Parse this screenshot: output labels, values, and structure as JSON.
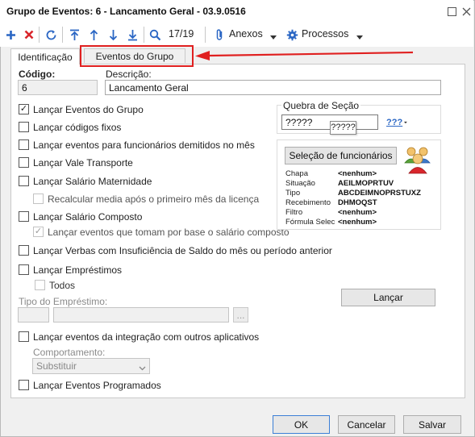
{
  "window": {
    "title": "Grupo de Eventos: 6 - Lancamento Geral - 03.9.0516"
  },
  "toolbar": {
    "record_counter": "17/19",
    "anexos_label": "Anexos",
    "processos_label": "Processos"
  },
  "tabs": [
    {
      "label": "Identificação"
    },
    {
      "label": "Eventos do Grupo"
    }
  ],
  "fields": {
    "codigo_label": "Código:",
    "codigo_value": "6",
    "descricao_label": "Descrição:",
    "descricao_value": "Lancamento Geral"
  },
  "options": {
    "lancar_eventos_grupo": "Lançar Eventos do Grupo",
    "lancar_codigos_fixos": "Lançar códigos fixos",
    "lancar_demitidos": "Lançar eventos para funcionários demitidos no mês",
    "lancar_vale_transporte": "Lançar Vale Transporte",
    "lancar_salario_maternidade": "Lançar Salário Maternidade",
    "recalcular_media": "Recalcular media após o primeiro mês da licença",
    "lancar_salario_composto": "Lançar Salário Composto",
    "lancar_eventos_base": "Lançar eventos que tomam por base o salário composto",
    "lancar_verbas_insuficiencia": "Lançar Verbas com Insuficiência de Saldo do mês ou período anterior",
    "lancar_emprestimos": "Lançar Empréstimos",
    "todos": "Todos",
    "tipo_emprestimo_label": "Tipo do Empréstimo:",
    "lancar_integracao": "Lançar eventos da integração com outros aplicativos",
    "comportamento_label": "Comportamento:",
    "comportamento_value": "Substituir",
    "lancar_programados": "Lançar Eventos Programados"
  },
  "quebra": {
    "label": "Quebra de Seção",
    "value": "?????",
    "tooltip": "?????",
    "selector_text": "???"
  },
  "selecao": {
    "button_label": "Seleção de funcionários",
    "rows": [
      {
        "key": "Chapa",
        "value": "<nenhum>"
      },
      {
        "key": "Situação",
        "value": "AEILMOPRTUV"
      },
      {
        "key": "Tipo",
        "value": "ABCDEIMNOPRSTUXZ"
      },
      {
        "key": "Recebimento",
        "value": "DHMOQST"
      },
      {
        "key": "Filtro",
        "value": "<nenhum>"
      },
      {
        "key": "Fórmula Selec",
        "value": "<nenhum>"
      }
    ]
  },
  "buttons": {
    "lancar": "Lançar",
    "browse": "...",
    "ok": "OK",
    "cancelar": "Cancelar",
    "salvar": "Salvar"
  },
  "colors": {
    "annotation_red": "#e02020",
    "accent_blue": "#2a66c4",
    "delete_red": "#d9262c"
  }
}
